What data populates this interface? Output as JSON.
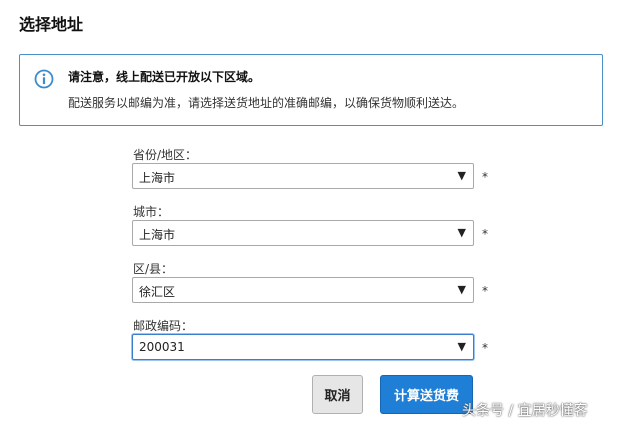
{
  "page": {
    "title": "选择地址"
  },
  "notice": {
    "title": "请注意，线上配送已开放以下区域。",
    "text": "配送服务以邮编为准，请选择送货地址的准确邮编，以确保货物顺利送达。",
    "icon": "info-icon",
    "border_color": "#4a8fc6"
  },
  "form": {
    "fields": [
      {
        "label": "省份/地区：",
        "value": "上海市",
        "required": "*"
      },
      {
        "label": "城市：",
        "value": "上海市",
        "required": "*"
      },
      {
        "label": "区/县：",
        "value": "徐汇区",
        "required": "*"
      },
      {
        "label": "邮政编码：",
        "value": "200031",
        "required": "*"
      }
    ],
    "cancel_label": "取消",
    "submit_label": "计算送货费",
    "submit_color": "#1f7fd6"
  },
  "watermark": {
    "text": "头条号 / 宜居秒懂客"
  }
}
